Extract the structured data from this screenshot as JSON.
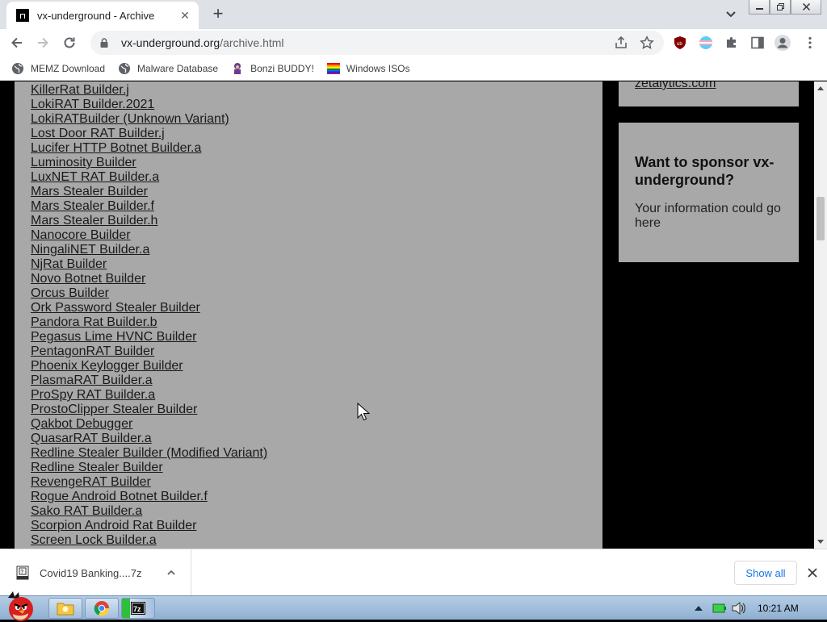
{
  "browser": {
    "tab_title": "vx-underground - Archive",
    "url_host": "vx-underground.org",
    "url_path": "/archive.html"
  },
  "bookmarks": [
    {
      "label": "MEMZ Download",
      "icon": "globe-icon"
    },
    {
      "label": "Malware Database",
      "icon": "globe-icon"
    },
    {
      "label": "Bonzi BUDDY!",
      "icon": "bonzi-icon"
    },
    {
      "label": "Windows ISOs",
      "icon": "rainbow-flag-icon"
    }
  ],
  "links": [
    "KillerRat Builder.j",
    "LokiRAT Builder.2021",
    "LokiRATBuilder (Unknown Variant)",
    "Lost Door RAT Builder.j",
    "Lucifer HTTP Botnet Builder.a",
    "Luminosity Builder",
    "LuxNET RAT Builder.a",
    "Mars Stealer Builder",
    "Mars Stealer Builder.f",
    "Mars Stealer Builder.h",
    "Nanocore Builder",
    "NingaliNET Builder.a",
    "NjRat Builder",
    "Novo Botnet Builder",
    "Orcus Builder",
    "Ork Password Stealer Builder",
    "Pandora Rat Builder.b",
    "Pegasus Lime HVNC Builder",
    "PentagonRAT Builder",
    "Phoenix Keylogger Builder",
    "PlasmaRAT Builder.a",
    "ProSpy RAT Builder.a",
    "ProstoClipper Stealer Builder",
    "Qakbot Debugger",
    "QuasarRAT Builder.a",
    "Redline Stealer Builder (Modified Variant)",
    "Redline Stealer Builder",
    "RevengeRAT Builder",
    "Rogue Android Botnet Builder.f",
    "Sako RAT Builder.a",
    "Scorpion Android Rat Builder",
    "Screen Lock Builder.a"
  ],
  "sidebar": {
    "top_link": "zetalytics.com",
    "sponsor_title": "Want to sponsor vx-underground?",
    "sponsor_text": "Your information could go here"
  },
  "downloads": {
    "file_name": "Covid19 Banking....7z",
    "show_all": "Show all"
  },
  "taskbar": {
    "clock": "10:21 AM"
  }
}
